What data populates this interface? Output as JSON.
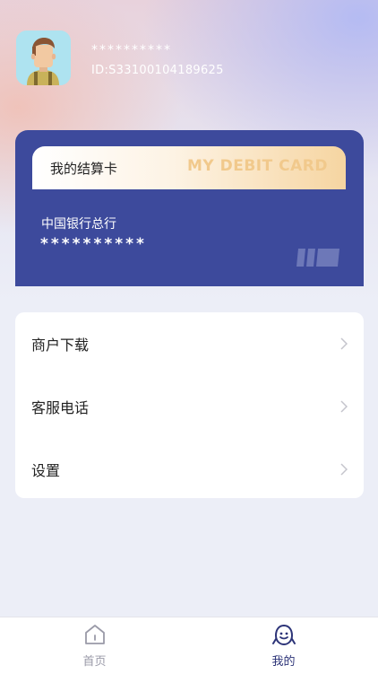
{
  "profile": {
    "name": "**********",
    "id_text": "ID:S33100104189625"
  },
  "card": {
    "title": "我的结算卡",
    "title_en": "MY DEBIT CARD",
    "bank_name": "中国银行总行",
    "number": "**********",
    "bg_color": "#3d4a9c",
    "accent_gold": "#f1c98c"
  },
  "menu": {
    "items": [
      {
        "label": "商户下载",
        "icon": "chevron-right-icon"
      },
      {
        "label": "客服电话",
        "icon": "chevron-right-icon"
      },
      {
        "label": "设置",
        "icon": "chevron-right-icon"
      }
    ]
  },
  "tabbar": {
    "tabs": [
      {
        "label": "首页",
        "icon": "home-icon",
        "active": false,
        "color": "#9a9aa8"
      },
      {
        "label": "我的",
        "icon": "profile-face-icon",
        "active": true,
        "color": "#2d3478"
      }
    ]
  }
}
